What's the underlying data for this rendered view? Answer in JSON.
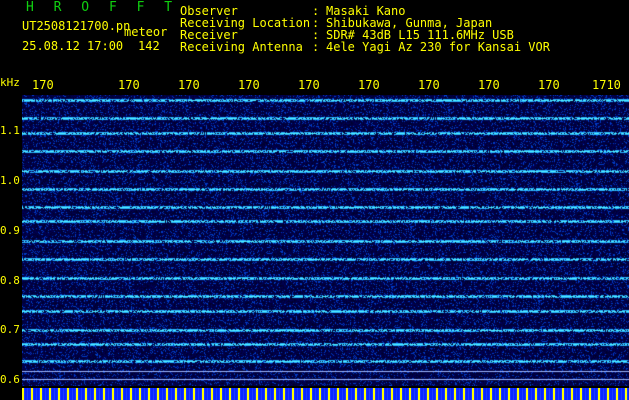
{
  "header": {
    "program": "H R O F F T",
    "filename": "UT2508121700.pn",
    "suffix": "meteor",
    "timestamp": "25.08.12 17:00",
    "count": "142"
  },
  "meta": {
    "labels": [
      "Observer",
      "Receiving Location",
      "Receiver",
      "Receiving Antenna"
    ],
    "colons": [
      ":",
      ":",
      ":",
      ":"
    ],
    "values": [
      "Masaki Kano",
      "Shibukawa, Gunma, Japan",
      "SDR# 43dB L15 111.6MHz USB",
      "4ele Yagi Az 230 for Kansai VOR"
    ]
  },
  "axes": {
    "y_unit": "kHz",
    "y_ticks": [
      "1.1",
      "1.0",
      "0.9",
      "0.8",
      "0.7",
      "0.6"
    ],
    "x_ticks": [
      "170",
      "170",
      "170",
      "170",
      "170",
      "170",
      "170",
      "170",
      "170",
      "1710"
    ]
  },
  "colors": {
    "background": "#00003a",
    "label": "#ffff00",
    "title": "#10d010",
    "band": "#3060ff"
  }
}
